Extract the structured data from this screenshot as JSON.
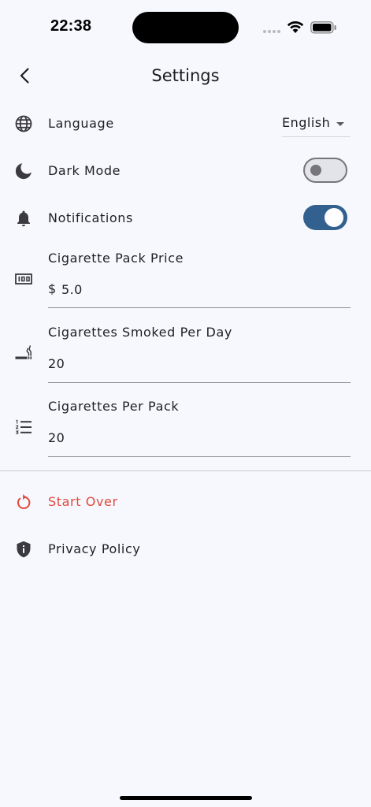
{
  "status_bar": {
    "time": "22:38"
  },
  "header": {
    "title": "Settings"
  },
  "settings": {
    "language": {
      "label": "Language",
      "selected": "English"
    },
    "dark_mode": {
      "label": "Dark Mode",
      "enabled": false
    },
    "notifications": {
      "label": "Notifications",
      "enabled": true
    },
    "pack_price": {
      "label": "Cigarette Pack Price",
      "prefix": "$",
      "value": "5.0"
    },
    "smoked_per_day": {
      "label": "Cigarettes Smoked Per Day",
      "value": "20"
    },
    "per_pack": {
      "label": "Cigarettes Per Pack",
      "value": "20"
    }
  },
  "actions": {
    "start_over": "Start Over",
    "privacy_policy": "Privacy Policy"
  },
  "colors": {
    "background": "#f7f8fd",
    "accent": "#33618f",
    "danger": "#e2483d"
  },
  "icons": {
    "language": "globe-icon",
    "dark_mode": "moon-icon",
    "notifications": "bell-icon",
    "pack_price": "money-icon",
    "smoked_per_day": "smoking-icon",
    "per_pack": "numbered-list-icon",
    "start_over": "restart-icon",
    "privacy_policy": "shield-icon"
  }
}
